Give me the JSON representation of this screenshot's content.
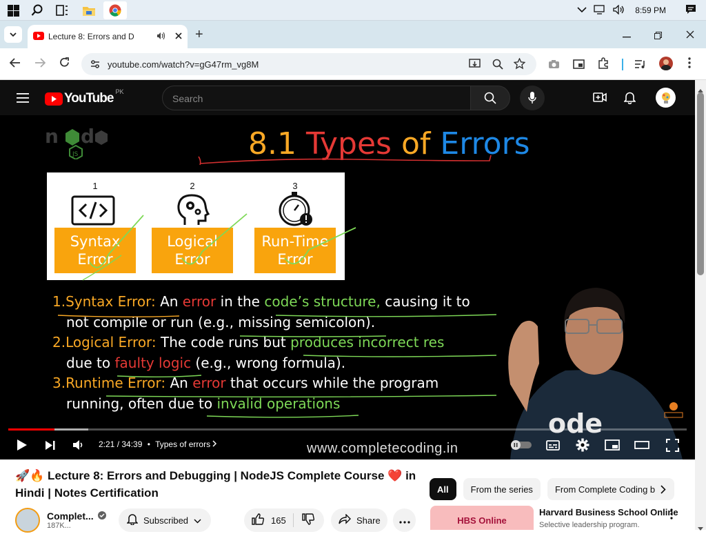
{
  "taskbar": {
    "time": "8:59 PM"
  },
  "browser": {
    "tab_title": "Lecture 8: Errors and D",
    "url": "youtube.com/watch?v=gG47rm_vg8M",
    "new_tab": "+"
  },
  "youtube": {
    "brand": "YouTube",
    "country": "PK",
    "search_placeholder": "Search"
  },
  "slide": {
    "title_num": "8.1",
    "title_w1": "Types",
    "title_w2": "of",
    "title_w3": "Errors",
    "cards": [
      {
        "num": "1",
        "line1": "Syntax",
        "line2": "Error"
      },
      {
        "num": "2",
        "line1": "Logical",
        "line2": "Error"
      },
      {
        "num": "3",
        "line1": "Run-Time",
        "line2": "Error"
      }
    ],
    "l1_a": "1.Syntax Error:",
    "l1_b": " An ",
    "l1_c": "error",
    "l1_d": " in the ",
    "l1_e": "code’s structure,",
    "l1_f": " causing it to",
    "l2": "not compile or run (e.g., missing semicolon).",
    "l3_a": "2.Logical Error:",
    "l3_b": " The code runs but ",
    "l3_c": "produces incorrect res",
    "l4_a": "due to ",
    "l4_b": "faulty logic",
    "l4_c": " (e.g., wrong formula).",
    "l5_a": "3.Runtime Error:",
    "l5_b": " An ",
    "l5_c": "error",
    "l5_d": " that occurs while the program",
    "l6_a": "running, often due to ",
    "l6_b": "invalid operations",
    "watermark": "www.completecoding.in"
  },
  "player": {
    "time": "2:21 / 34:39",
    "chapter": "Types of errors",
    "progress_fraction": 0.0677,
    "buffer_fraction": 0.118
  },
  "video": {
    "title_line1": "🚀🔥 Lecture 8: Errors and Debugging | NodeJS Complete Course ❤️ in",
    "title_line2": "Hindi | Notes Certification",
    "channel": "Complet...",
    "subs": "187K...",
    "subscribed": "Subscribed",
    "likes": "165",
    "share": "Share"
  },
  "sidebar": {
    "chips": [
      "All",
      "From the series",
      "From Complete Coding b"
    ],
    "ad_thumb": "HBS Online",
    "ad_title": "Harvard Business School Online",
    "ad_sub": "Selective leadership program."
  },
  "colors": {
    "yt_red": "#ff0000",
    "accent_orange": "#f9a40d"
  }
}
